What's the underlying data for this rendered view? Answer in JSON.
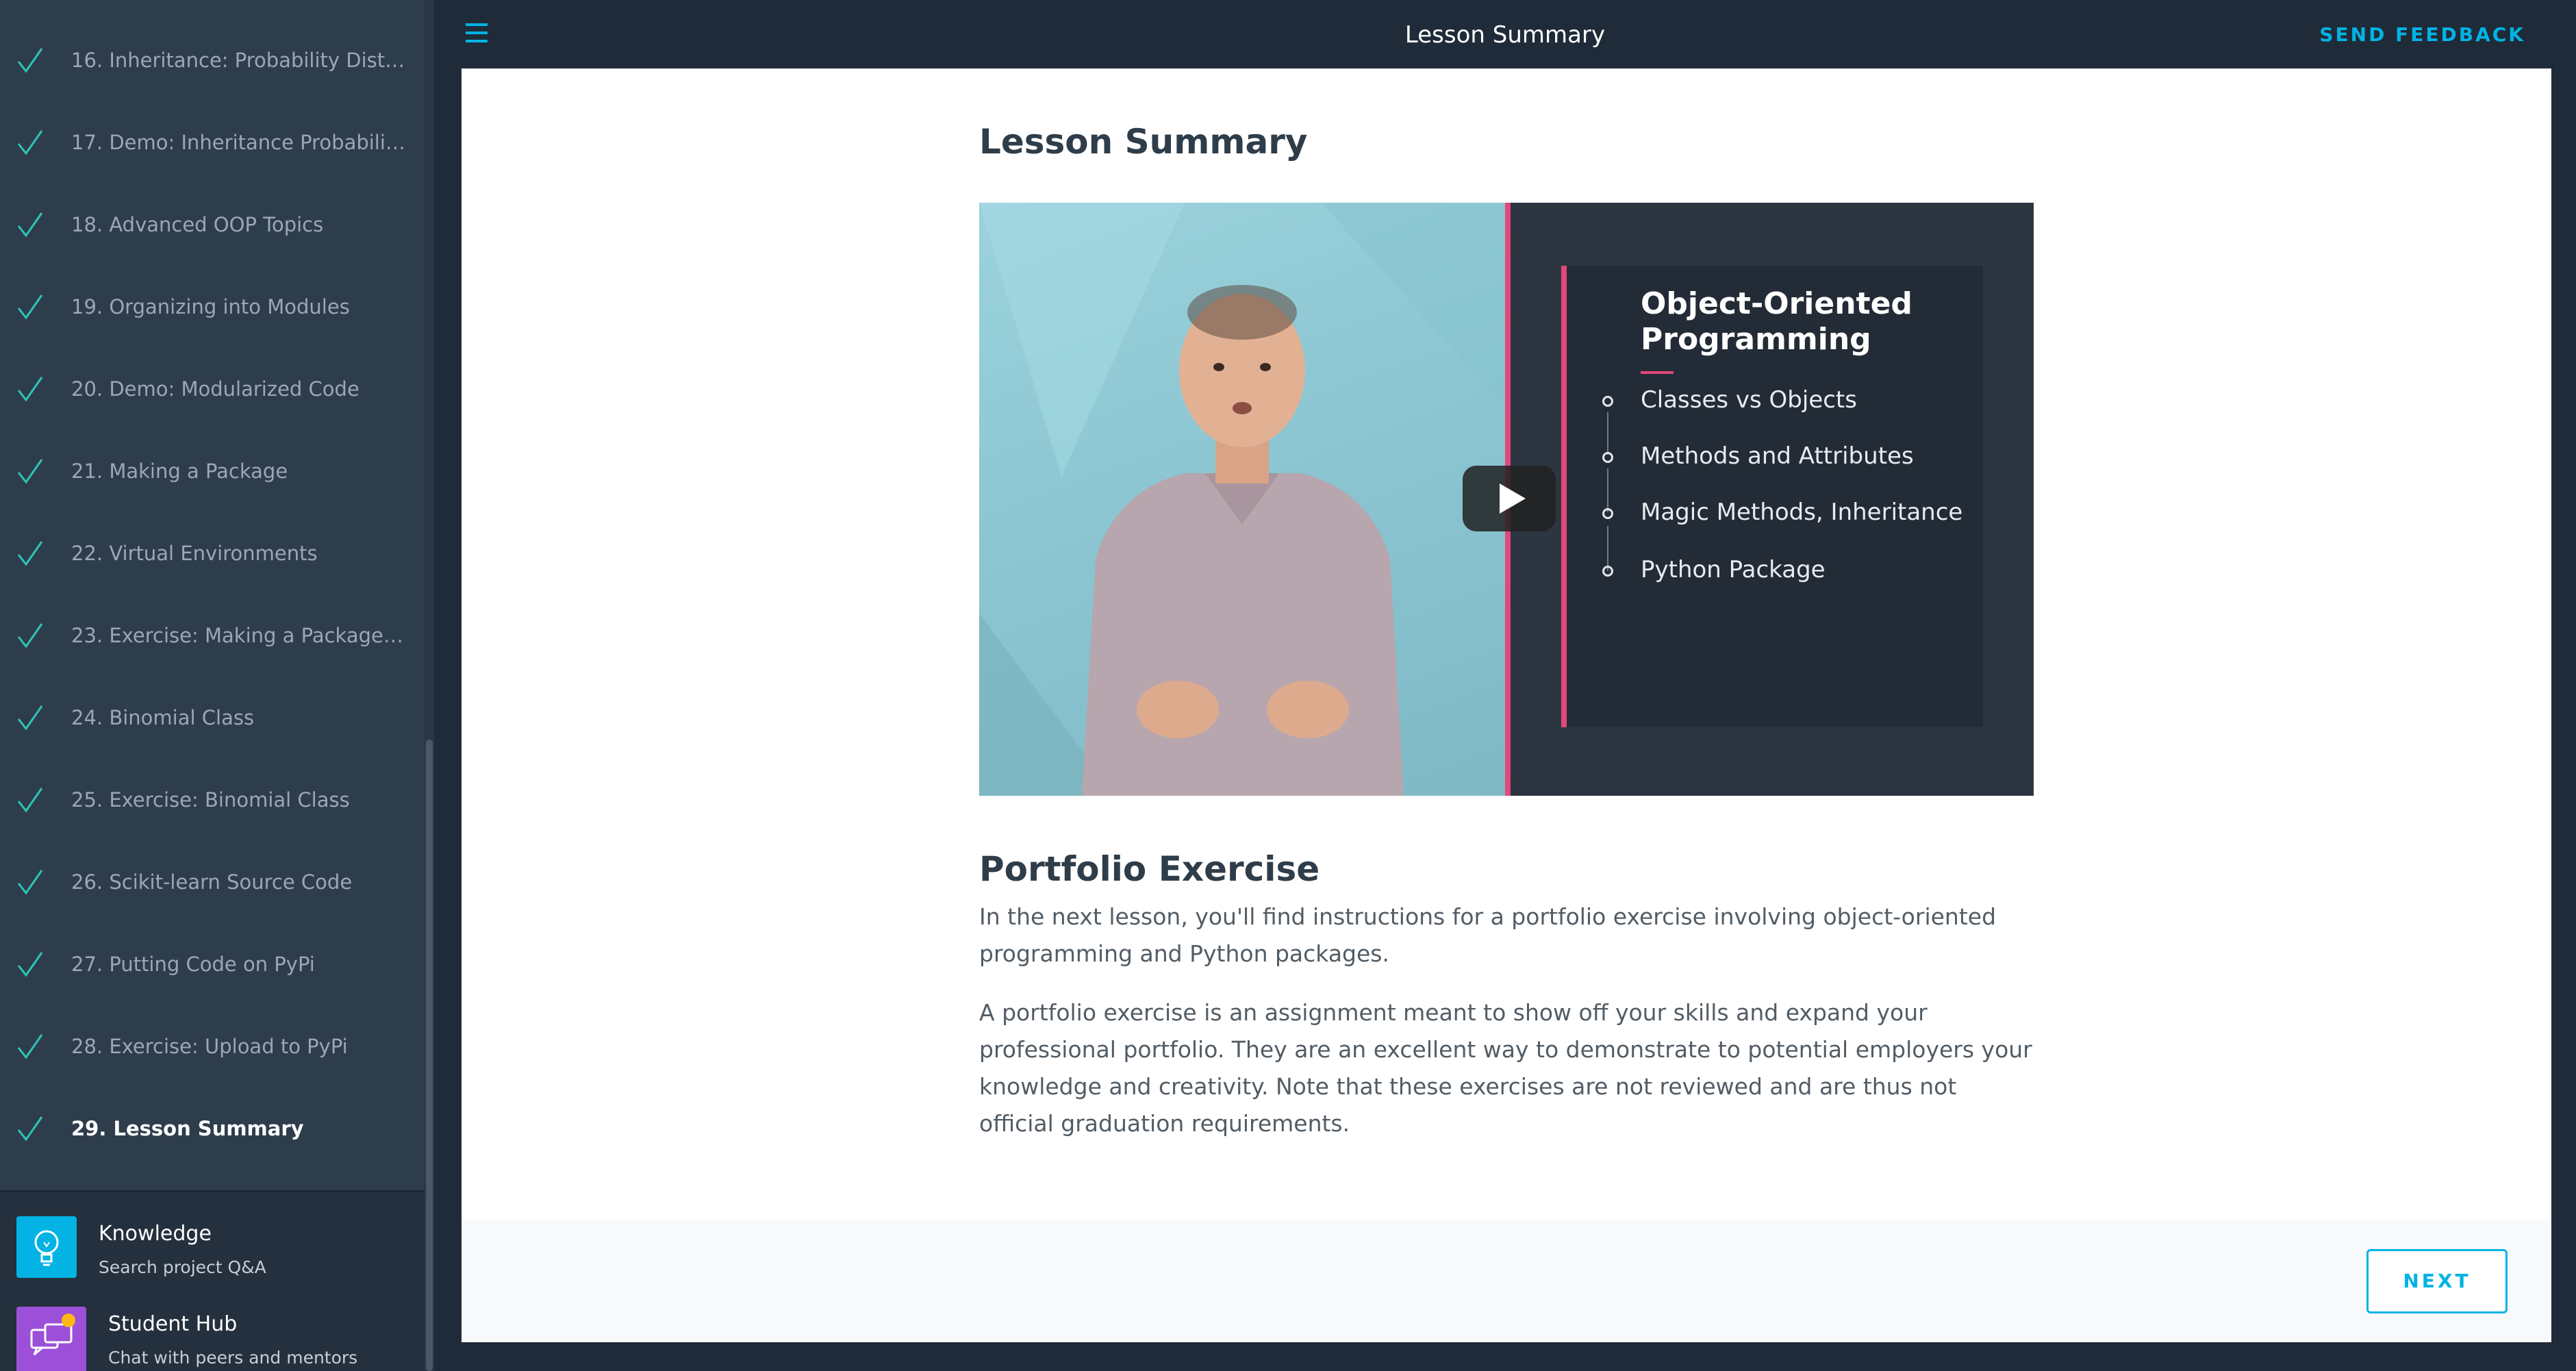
{
  "sidebar": {
    "lessons": [
      {
        "label": "16. Inheritance: Probability Distribu...",
        "completed": true,
        "active": false
      },
      {
        "label": "17. Demo: Inheritance Probability D...",
        "completed": true,
        "active": false
      },
      {
        "label": "18. Advanced OOP Topics",
        "completed": true,
        "active": false
      },
      {
        "label": "19. Organizing into Modules",
        "completed": true,
        "active": false
      },
      {
        "label": "20. Demo: Modularized Code",
        "completed": true,
        "active": false
      },
      {
        "label": "21. Making a Package",
        "completed": true,
        "active": false
      },
      {
        "label": "22. Virtual Environments",
        "completed": true,
        "active": false
      },
      {
        "label": "23. Exercise: Making a Package and ...",
        "completed": true,
        "active": false
      },
      {
        "label": "24. Binomial Class",
        "completed": true,
        "active": false
      },
      {
        "label": "25. Exercise: Binomial Class",
        "completed": true,
        "active": false
      },
      {
        "label": "26. Scikit-learn Source Code",
        "completed": true,
        "active": false
      },
      {
        "label": "27. Putting Code on PyPi",
        "completed": true,
        "active": false
      },
      {
        "label": "28. Exercise: Upload to PyPi",
        "completed": true,
        "active": false
      },
      {
        "label": "29. Lesson Summary",
        "completed": true,
        "active": true
      }
    ],
    "footer": {
      "knowledge": {
        "title": "Knowledge",
        "subtitle": "Search project Q&A",
        "icon": "lightbulb-icon",
        "color": "#02b3e4"
      },
      "student_hub": {
        "title": "Student Hub",
        "subtitle": "Chat with peers and mentors",
        "icon": "chat-bubbles-icon",
        "color": "#9c4fd8",
        "badge_color": "#fdb813"
      }
    }
  },
  "header": {
    "title": "Lesson Summary",
    "feedback_label": "SEND FEEDBACK",
    "menu_icon": "hamburger-menu-icon"
  },
  "main": {
    "page_title": "Lesson Summary",
    "video": {
      "slide_title": "Object-Oriented Programming",
      "slide_points": [
        "Classes vs Objects",
        "Methods and Attributes",
        "Magic Methods, Inheritance",
        "Python Package"
      ],
      "play_icon": "play-icon"
    },
    "section_title": "Portfolio Exercise",
    "paragraphs": [
      "In the next lesson, you'll find instructions for a portfolio exercise involving object-oriented programming and Python packages.",
      "A portfolio exercise is an assignment meant to show off your skills and expand your professional portfolio. They are an excellent way to demonstrate to potential employers your knowledge and creativity. Note that these exercises are not reviewed and are thus not official graduation requirements."
    ],
    "next_label": "NEXT"
  },
  "colors": {
    "accent": "#02b3e4",
    "check": "#2ec4b6",
    "slide_accent": "#e2487a",
    "sidebar_bg": "#2e3d4c"
  }
}
